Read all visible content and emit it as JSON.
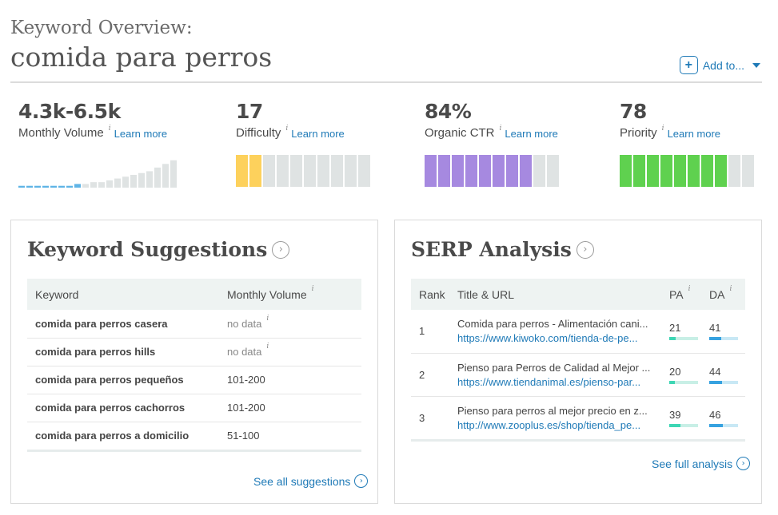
{
  "header": {
    "pretitle": "Keyword Overview:",
    "keyword": "comida para perros",
    "add_to_label": "Add to..."
  },
  "metrics": [
    {
      "value": "4.3k-6.5k",
      "label": "Monthly Volume",
      "learn": "Learn more",
      "bars": [
        1,
        1,
        1,
        1,
        1,
        1,
        1,
        2,
        2,
        3,
        3,
        4,
        5,
        6,
        7,
        8,
        9,
        11,
        13,
        15,
        17,
        21
      ]
    },
    {
      "value": "17",
      "label": "Difficulty",
      "learn": "Learn more",
      "score": 17,
      "color": "#fdd15c"
    },
    {
      "value": "84%",
      "label": "Organic CTR",
      "learn": "Learn more",
      "score": 84,
      "color": "#a689e0"
    },
    {
      "value": "78",
      "label": "Priority",
      "learn": "Learn more",
      "score": 78,
      "color": "#5fd14f"
    }
  ],
  "info_glyph": "i",
  "suggestions": {
    "title": "Keyword Suggestions",
    "col_keyword": "Keyword",
    "col_volume": "Monthly Volume",
    "rows": [
      {
        "keyword": "comida para perros casera",
        "volume": "no data",
        "nodata": true
      },
      {
        "keyword": "comida para perros hills",
        "volume": "no data",
        "nodata": true
      },
      {
        "keyword": "comida para perros pequeños",
        "volume": "101-200",
        "nodata": false
      },
      {
        "keyword": "comida para perros cachorros",
        "volume": "101-200",
        "nodata": false
      },
      {
        "keyword": "comida para perros a domicilio",
        "volume": "51-100",
        "nodata": false
      }
    ],
    "see_all": "See all suggestions"
  },
  "serp": {
    "title": "SERP Analysis",
    "col_rank": "Rank",
    "col_title": "Title & URL",
    "col_pa": "PA",
    "col_da": "DA",
    "rows": [
      {
        "rank": "1",
        "title": "Comida para perros - Alimentación cani...",
        "url": "https://www.kiwoko.com/tienda-de-pe...",
        "pa": "21",
        "da": "41"
      },
      {
        "rank": "2",
        "title": "Pienso para Perros de Calidad al Mejor ...",
        "url": "https://www.tiendanimal.es/pienso-par...",
        "pa": "20",
        "da": "44"
      },
      {
        "rank": "3",
        "title": "Pienso para perros al mejor precio en z...",
        "url": "http://www.zooplus.es/shop/tienda_pe...",
        "pa": "39",
        "da": "46"
      }
    ],
    "see_full": "See full analysis"
  }
}
